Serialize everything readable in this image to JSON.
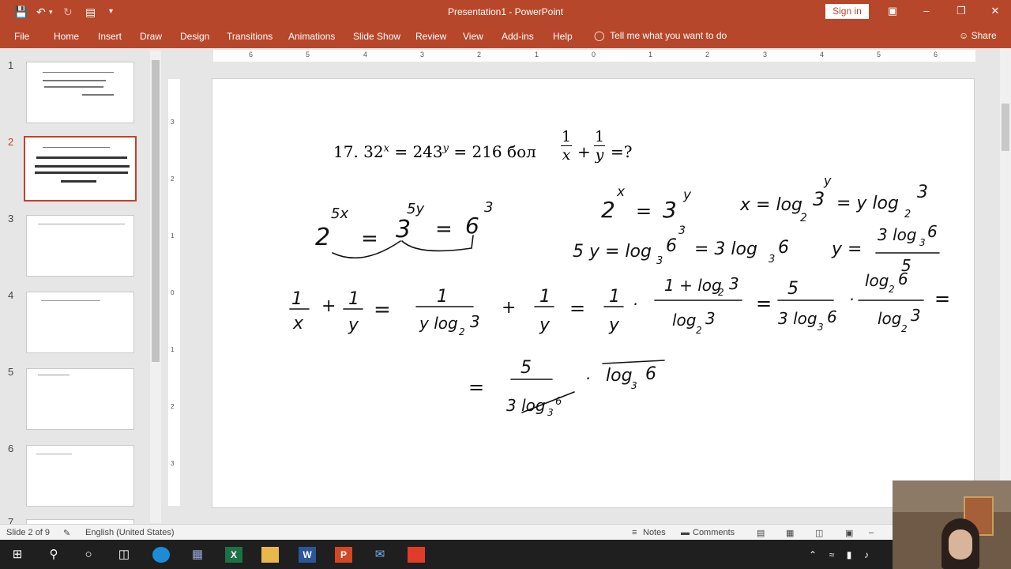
{
  "app": {
    "title": "Presentation1  -  PowerPoint",
    "sign_in": "Sign in"
  },
  "ribbon": {
    "tabs": [
      "File",
      "Home",
      "Insert",
      "Draw",
      "Design",
      "Transitions",
      "Animations",
      "Slide Show",
      "Review",
      "View",
      "Add-ins",
      "Help"
    ],
    "tell_me": "Tell me what you want to do",
    "share": "Share"
  },
  "thumbnails": {
    "numbers": [
      "1",
      "2",
      "3",
      "4",
      "5",
      "6",
      "7"
    ],
    "active_index": 1
  },
  "ruler": {
    "horizontal": [
      "6",
      "5",
      "4",
      "3",
      "2",
      "1",
      "0",
      "1",
      "2",
      "3",
      "4",
      "5",
      "6"
    ],
    "vertical": [
      "3",
      "2",
      "1",
      "0",
      "1",
      "2",
      "3"
    ]
  },
  "slide": {
    "problem_number": "17.",
    "base1": "32",
    "base2": "243",
    "value": "216",
    "word": "бол",
    "exp_x": "x",
    "exp_y": "y",
    "question": "=?",
    "one": "1"
  },
  "status": {
    "slide_info": "Slide 2 of 9",
    "language": "English (United States)",
    "notes": "Notes",
    "comments": "Comments"
  },
  "colors": {
    "accent": "#b7472a",
    "active_thumb": "#c4402a"
  }
}
